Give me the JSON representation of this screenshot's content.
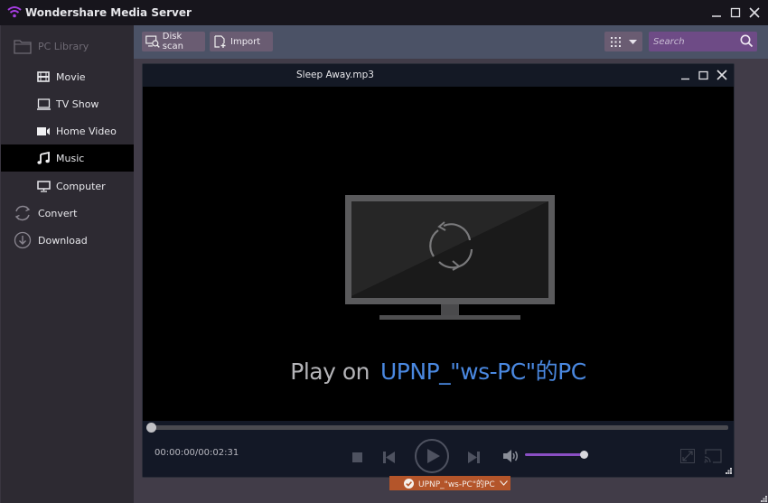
{
  "app": {
    "title": "Wondershare Media Server",
    "window_controls": {
      "minimize": "minimize",
      "maximize": "maximize",
      "close": "close"
    }
  },
  "sidebar": {
    "group_label": "PC Library",
    "items": [
      {
        "label": "Movie",
        "icon": "film-icon"
      },
      {
        "label": "TV Show",
        "icon": "tv-icon"
      },
      {
        "label": "Home Video",
        "icon": "video-camera-icon"
      },
      {
        "label": "Music",
        "icon": "music-note-icon",
        "active": true
      },
      {
        "label": "Computer",
        "icon": "monitor-icon"
      }
    ],
    "top_items": [
      {
        "label": "Convert",
        "icon": "convert-icon"
      },
      {
        "label": "Download",
        "icon": "download-icon"
      }
    ]
  },
  "toolbar": {
    "disk_scan_label": "Disk scan",
    "import_label": "Import",
    "search_placeholder": "Search",
    "search_value": ""
  },
  "player": {
    "title": "Sleep Away.mp3",
    "play_on_prefix": "Play on",
    "device_name": "UPNP_\"ws-PC\"的PC",
    "current_time": "00:00:00",
    "duration": "00:02:31",
    "time_display": "00:00:00/00:02:31",
    "progress_fraction": 0.0,
    "volume_fraction": 1.0,
    "is_playing": false
  },
  "device_badge": {
    "label": "UPNP_\"ws-PC\"的PC",
    "checked": true
  },
  "colors": {
    "accent_purple": "#8a4fc4",
    "device_link_blue": "#4a88e0",
    "badge_orange": "#b4552a",
    "search_purple": "#6e4b86",
    "toolbar_slate": "#4b5266"
  }
}
